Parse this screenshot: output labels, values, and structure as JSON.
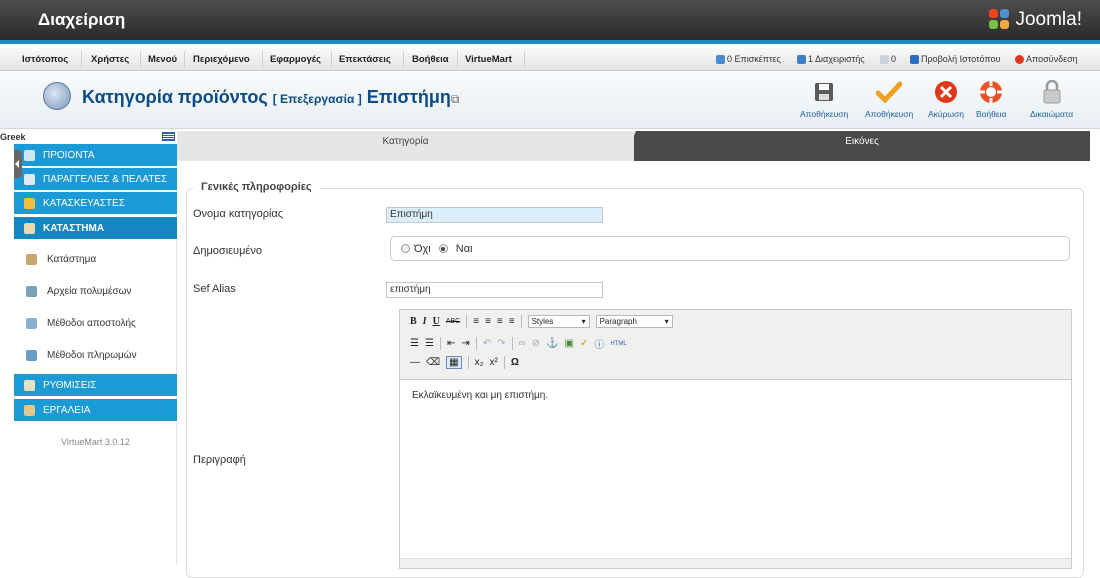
{
  "header": {
    "title": "Διαχείριση",
    "brand": "Joomla!"
  },
  "menu": [
    "Ιστότοπος",
    "Χρήστες",
    "Μενού",
    "Περιεχόμενο",
    "Εφαρμογές",
    "Επεκτάσεις",
    "Βοήθεια",
    "VirtueMart"
  ],
  "status": {
    "visitors": "0 Επισκέπτες",
    "admins": "1 Διαχειριστής",
    "messages": "0",
    "view_site": "Προβολή Ιστοτόπου",
    "logout": "Αποσύνδεση"
  },
  "page": {
    "title_main": "Κατηγορία προϊόντος",
    "title_edit": "[ Επεξεργασία ]",
    "title_item": "Επιστήμη"
  },
  "toolbar": {
    "save": "Αποθήκευση",
    "save_close": "Αποθήκευση",
    "cancel": "Ακύρωση",
    "help": "Βοήθεια",
    "permissions": "Δικαιώματα"
  },
  "sidebar": {
    "language": "Greek",
    "items": [
      {
        "label": "ΠΡΟΙΟΝΤΑ"
      },
      {
        "label": "ΠΑΡΑΓΓΕΛΙΕΣ & ΠΕΛΑΤΕΣ"
      },
      {
        "label": "ΚΑΤΑΣΚΕΥΑΣΤΕΣ"
      },
      {
        "label": "ΚΑΤΑΣΤΗΜΑ"
      },
      {
        "label": "Κατάστημα"
      },
      {
        "label": "Αρχεία πολυμέσων"
      },
      {
        "label": "Μέθοδοι αποστολής"
      },
      {
        "label": "Μέθοδοι πληρωμών"
      },
      {
        "label": "ΡΥΘΜΙΣΕΙΣ"
      },
      {
        "label": "ΕΡΓΑΛΕΙΑ"
      }
    ],
    "version": "VirtueMart 3.0.12"
  },
  "tabs": {
    "category": "Κατηγορία",
    "images": "Εικόνες"
  },
  "form": {
    "legend": "Γενικές πληροφορίες",
    "name_label": "Ονομα κατηγορίας",
    "name_value": "Επιστήμη",
    "published_label": "Δημοσιευμένο",
    "published_no": "Όχι",
    "published_yes": "Ναι",
    "alias_label": "Sef Alias",
    "alias_value": "επιστήμη",
    "description_label": "Περιγραφή"
  },
  "editor": {
    "styles": "Styles",
    "format": "Paragraph",
    "content": "Εκλαϊκευμένη και μη επιστήμη."
  },
  "colors": {
    "accent": "#1c9ad6",
    "title": "#0b4b86"
  }
}
